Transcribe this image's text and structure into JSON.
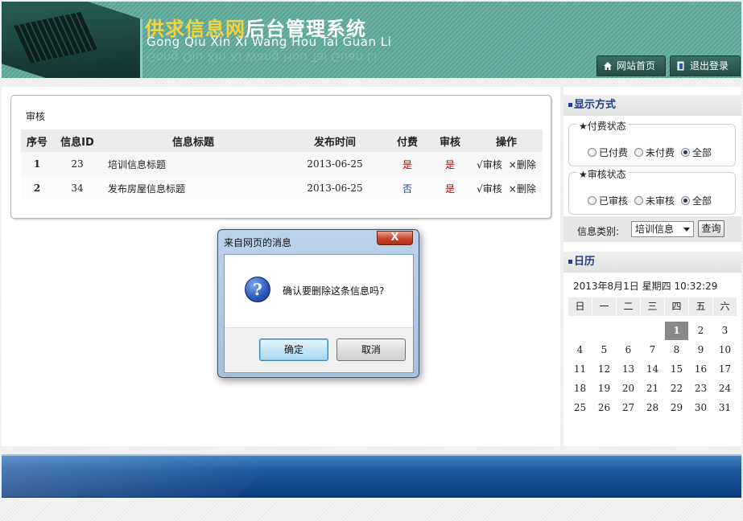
{
  "header": {
    "title_brand": "供求信息网",
    "title_rest": "后台管理系统",
    "subtitle": "Gong Qiu Xin Xi Wang Hou Tai Guan Li",
    "nav": [
      {
        "label": "网站首页",
        "icon": "home-icon"
      },
      {
        "label": "退出登录",
        "icon": "exit-icon"
      }
    ]
  },
  "panel": {
    "title": "审核",
    "columns": [
      "序号",
      "信息ID",
      "信息标题",
      "发布时间",
      "付费",
      "审核",
      "操作"
    ],
    "rows": [
      {
        "num": "1",
        "id": "23",
        "title": "培训信息标题",
        "date": "2013-06-25",
        "paid": "是",
        "audited": "是",
        "action_audit": "√审核",
        "action_delete": "×删除"
      },
      {
        "num": "2",
        "id": "34",
        "title": "发布房屋信息标题",
        "date": "2013-06-25",
        "paid": "否",
        "audited": "是",
        "action_audit": "√审核",
        "action_delete": "×删除"
      }
    ]
  },
  "sidebar": {
    "display_heading": "显示方式",
    "pay_group": {
      "legend": "★付费状态",
      "options": [
        "已付费",
        "未付费",
        "全部"
      ],
      "selected": "全部"
    },
    "audit_group": {
      "legend": "★审核状态",
      "options": [
        "已审核",
        "未审核",
        "全部"
      ],
      "selected": "全部"
    },
    "category_label": "信息类别:",
    "category_value": "培训信息",
    "query_label": "查询",
    "calendar_heading": "日历",
    "calendar": {
      "now": "2013年8月1日  星期四  10:32:29",
      "weekdays": [
        "日",
        "一",
        "二",
        "三",
        "四",
        "五",
        "六"
      ],
      "first_weekday_index": 4,
      "days_in_month": 31,
      "today": 1
    }
  },
  "dialog": {
    "title": "来自网页的消息",
    "close_label": "X",
    "message": "确认要删除这条信息吗?",
    "ok_label": "确定",
    "cancel_label": "取消"
  },
  "colors": {
    "header_teal": "#5aa295",
    "accent_blue": "#1d3f8a",
    "yes_red": "#c00000",
    "footer_blue": "#1e5aa0"
  }
}
